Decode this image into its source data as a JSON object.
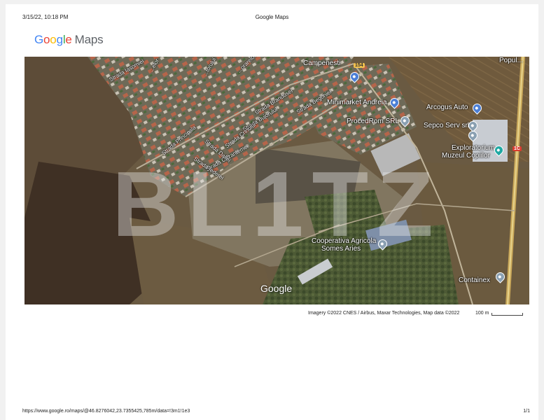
{
  "header": {
    "datetime": "3/15/22, 10:18 PM",
    "title": "Google Maps"
  },
  "logo": {
    "google": [
      "G",
      "o",
      "o",
      "g",
      "l",
      "e"
    ],
    "google_colors": [
      "#4285F4",
      "#EA4335",
      "#FBBC05",
      "#4285F4",
      "#34A853",
      "#EA4335"
    ],
    "maps": "Maps"
  },
  "map": {
    "watermark": "BL1TZ",
    "google_mark": "Google",
    "places": {
      "campenesti": "Campenesti",
      "minimarket": "Minimarket Andreia",
      "arcogus": "Arcogus Auto",
      "procedrom": "ProcedRom SRL",
      "sepco": "Sepco Serv srl",
      "explor_1": "Exploratorium",
      "explor_2": "Muzeul Copiilor",
      "cooperativa_1": "Cooperativa Agricola",
      "cooperativa_2": "Somes Aries",
      "containex": "Containex",
      "topright": "Popul..."
    },
    "streets": {
      "jasomiei": "Strada Iasomiei",
      "brandusei": "Strada Brandusei",
      "begoniei": "Strada Begoniei",
      "bujorului": "Strada Bujorului",
      "principala": "Strada Principala",
      "crinului": "Strada Crinului",
      "crizantemei": "Strada Crizantemei",
      "daliei": "Strada Daliei",
      "iederei": "Strada Iederei",
      "top_a": "...elor",
      "top_b": "...torului",
      "top_c": "...orarelor"
    },
    "routes": {
      "r154": "154",
      "r1c": "1C"
    },
    "icons": [
      "pin-icon",
      "bus-icon",
      "route-shield-icon"
    ]
  },
  "attribution": "Imagery ©2022 CNES / Airbus, Maxar Technologies, Map data ©2022",
  "scale": {
    "label": "100 m"
  },
  "footer": {
    "url": "https://www.google.ro/maps/@46.8276042,23.7355425,785m/data=!3m1!1e3",
    "page": "1/1"
  }
}
